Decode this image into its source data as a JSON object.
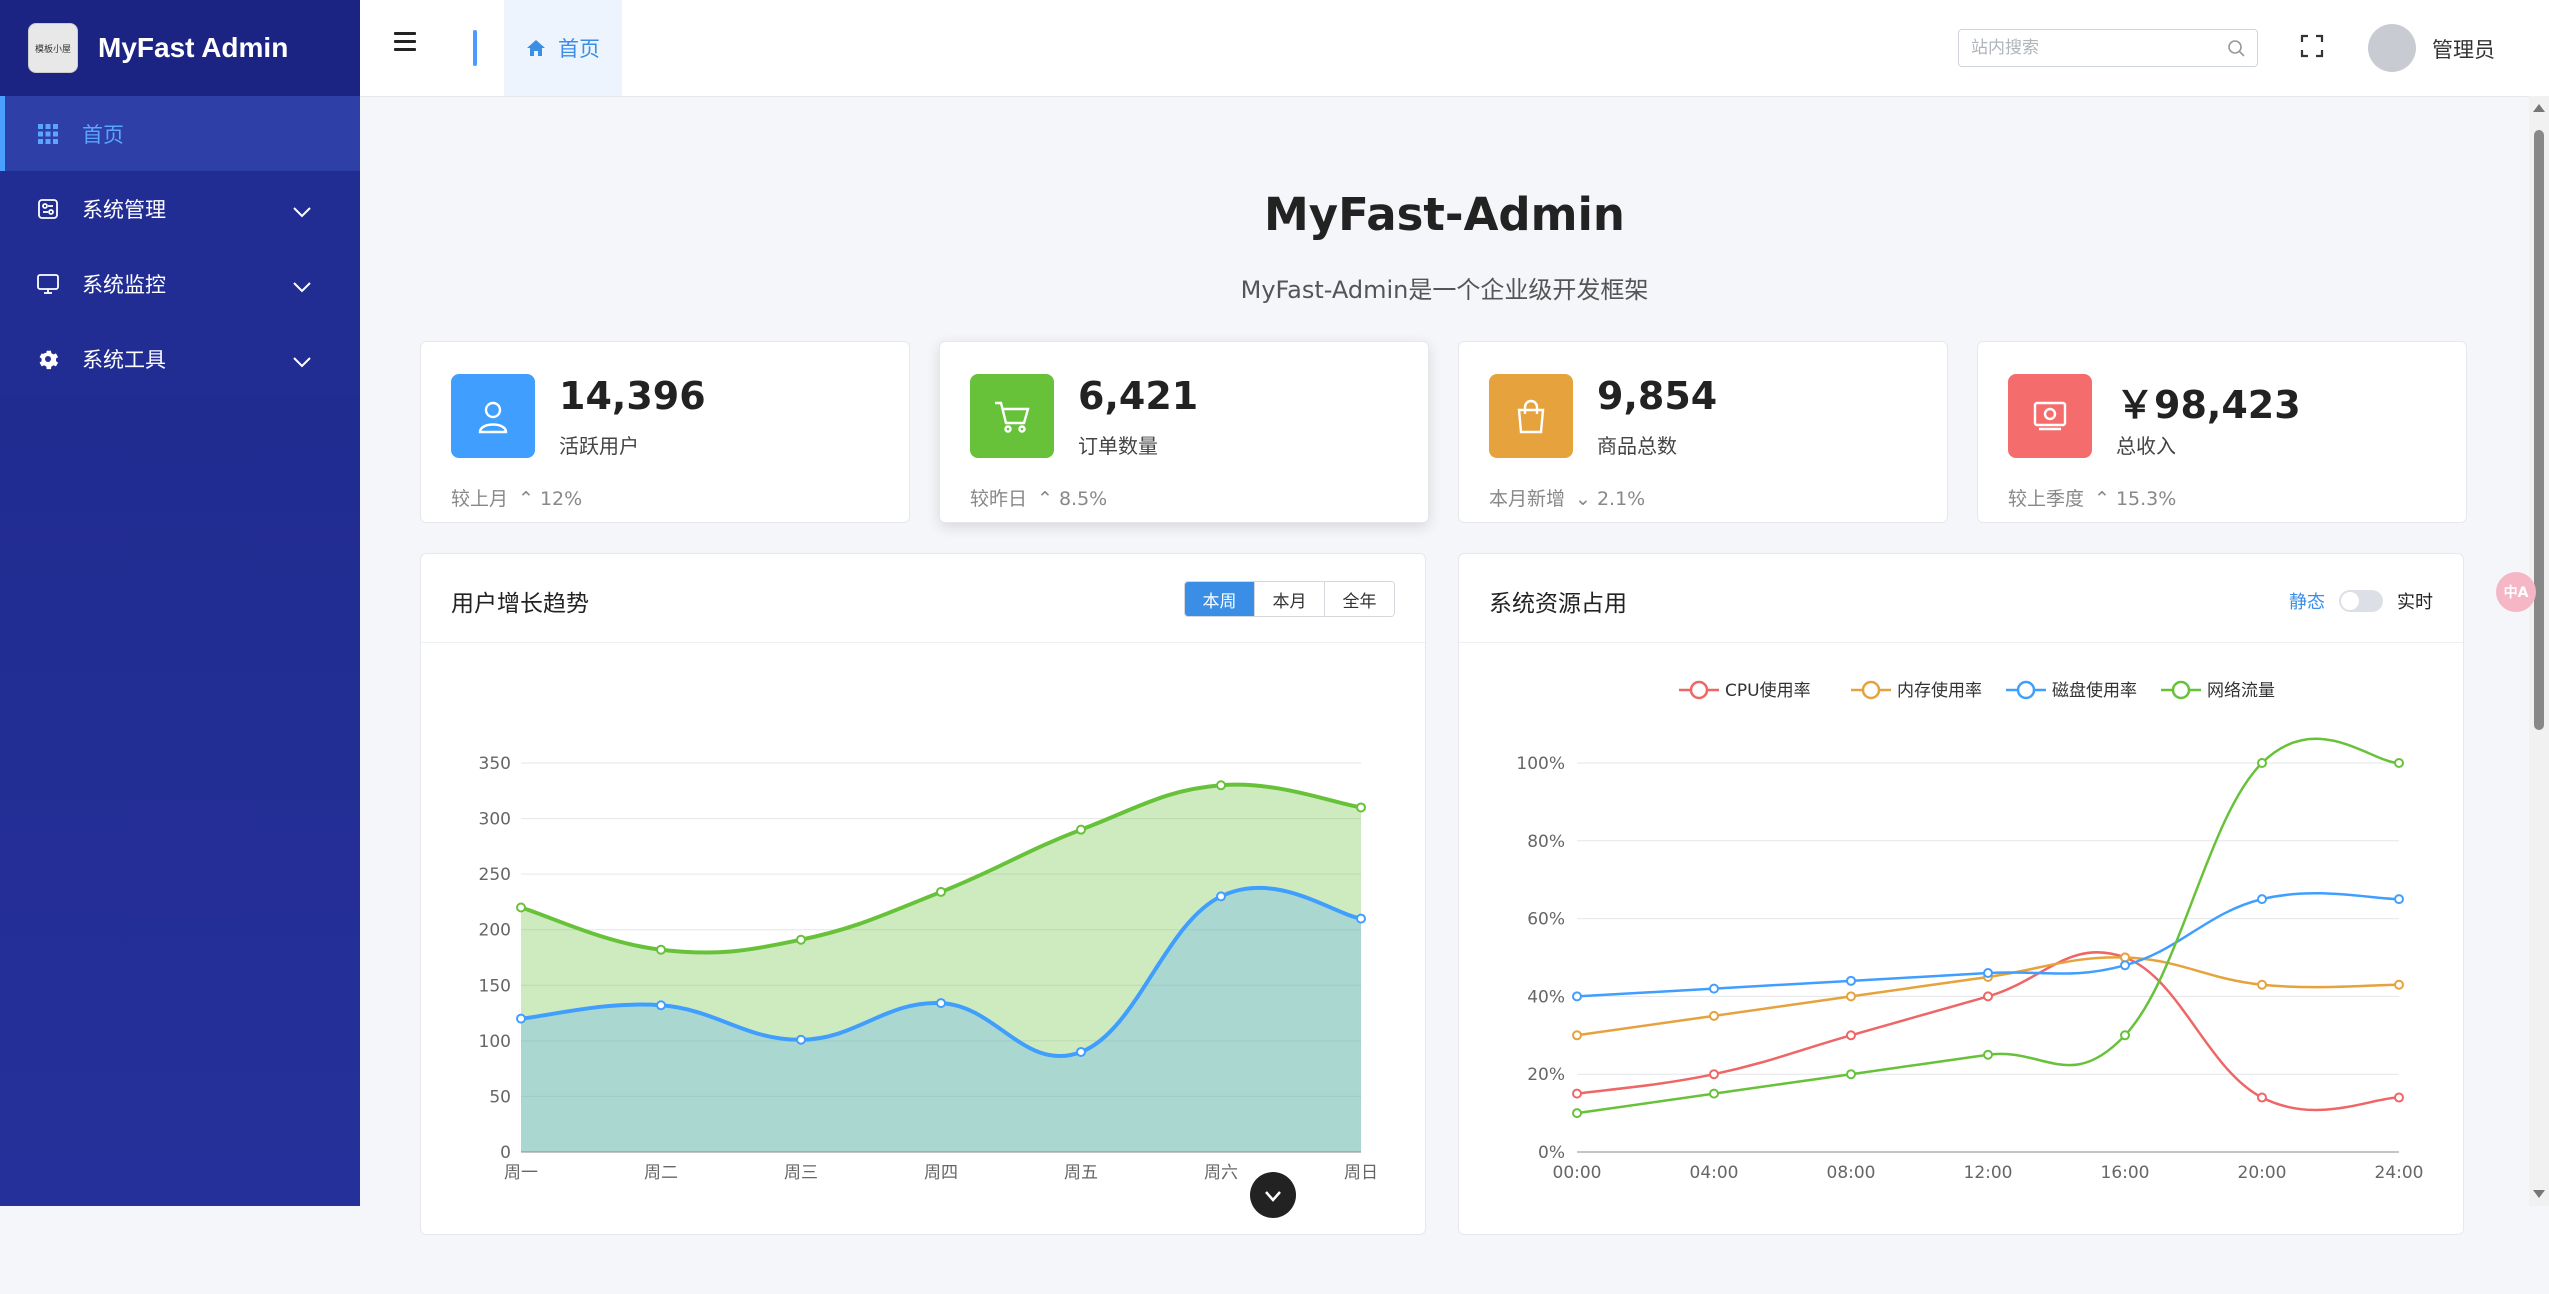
{
  "app": {
    "name": "MyFast Admin",
    "logo_text": "模板小屋"
  },
  "sidebar": {
    "items": [
      {
        "label": "首页",
        "icon": "grid-icon",
        "active": true
      },
      {
        "label": "系统管理",
        "icon": "settings-panel-icon"
      },
      {
        "label": "系统监控",
        "icon": "monitor-icon"
      },
      {
        "label": "系统工具",
        "icon": "gear-icon"
      }
    ]
  },
  "topbar": {
    "tab_home": "首页",
    "search_placeholder": "站内搜索",
    "username": "管理员"
  },
  "hero": {
    "title": "MyFast-Admin",
    "subtitle": "MyFast-Admin是一个企业级开发框架"
  },
  "stats": [
    {
      "value": "14,396",
      "label": "活跃用户",
      "trend_label": "较上月",
      "trend_dir": "up",
      "trend_value": "12%",
      "color": "#409eff",
      "icon": "user-icon"
    },
    {
      "value": "6,421",
      "label": "订单数量",
      "trend_label": "较昨日",
      "trend_dir": "up",
      "trend_value": "8.5%",
      "color": "#67c23a",
      "icon": "cart-icon"
    },
    {
      "value": "9,854",
      "label": "商品总数",
      "trend_label": "本月新增",
      "trend_dir": "down",
      "trend_value": "2.1%",
      "color": "#e6a23c",
      "icon": "bag-icon"
    },
    {
      "value": "￥98,423",
      "label": "总收入",
      "trend_label": "较上季度",
      "trend_dir": "up",
      "trend_value": "15.3%",
      "color": "#f56c6c",
      "icon": "money-icon"
    }
  ],
  "panel_growth": {
    "title": "用户增长趋势",
    "tabs": [
      "本周",
      "本月",
      "全年"
    ],
    "active_tab": 0
  },
  "panel_resource": {
    "title": "系统资源占用",
    "toggle_static": "静态",
    "toggle_realtime": "实时"
  },
  "chart_data": [
    {
      "type": "area",
      "categories": [
        "周一",
        "周二",
        "周三",
        "周四",
        "周五",
        "周六",
        "周日"
      ],
      "ylim": [
        0,
        350
      ],
      "yticks": [
        0,
        50,
        100,
        150,
        200,
        250,
        300,
        350
      ],
      "series": [
        {
          "values": [
            220,
            182,
            191,
            234,
            290,
            330,
            310
          ],
          "color": "#67c23a"
        },
        {
          "values": [
            120,
            132,
            101,
            134,
            90,
            230,
            210
          ],
          "color": "#409eff"
        }
      ]
    },
    {
      "type": "line",
      "categories": [
        "00:00",
        "04:00",
        "08:00",
        "12:00",
        "16:00",
        "20:00",
        "24:00"
      ],
      "ylim": [
        0,
        100
      ],
      "yticks": [
        "0%",
        "20%",
        "40%",
        "60%",
        "80%",
        "100%"
      ],
      "legend_position": "top",
      "series": [
        {
          "name": "CPU使用率",
          "values": [
            15,
            20,
            30,
            40,
            50,
            14,
            14
          ],
          "color": "#ee6666"
        },
        {
          "name": "内存使用率",
          "values": [
            30,
            35,
            40,
            45,
            50,
            43,
            43
          ],
          "color": "#e6a23c"
        },
        {
          "name": "磁盘使用率",
          "values": [
            40,
            42,
            44,
            46,
            48,
            65,
            65
          ],
          "color": "#409eff"
        },
        {
          "name": "网络流量",
          "values": [
            10,
            15,
            20,
            25,
            30,
            100,
            100
          ],
          "color": "#67c23a"
        }
      ]
    }
  ]
}
